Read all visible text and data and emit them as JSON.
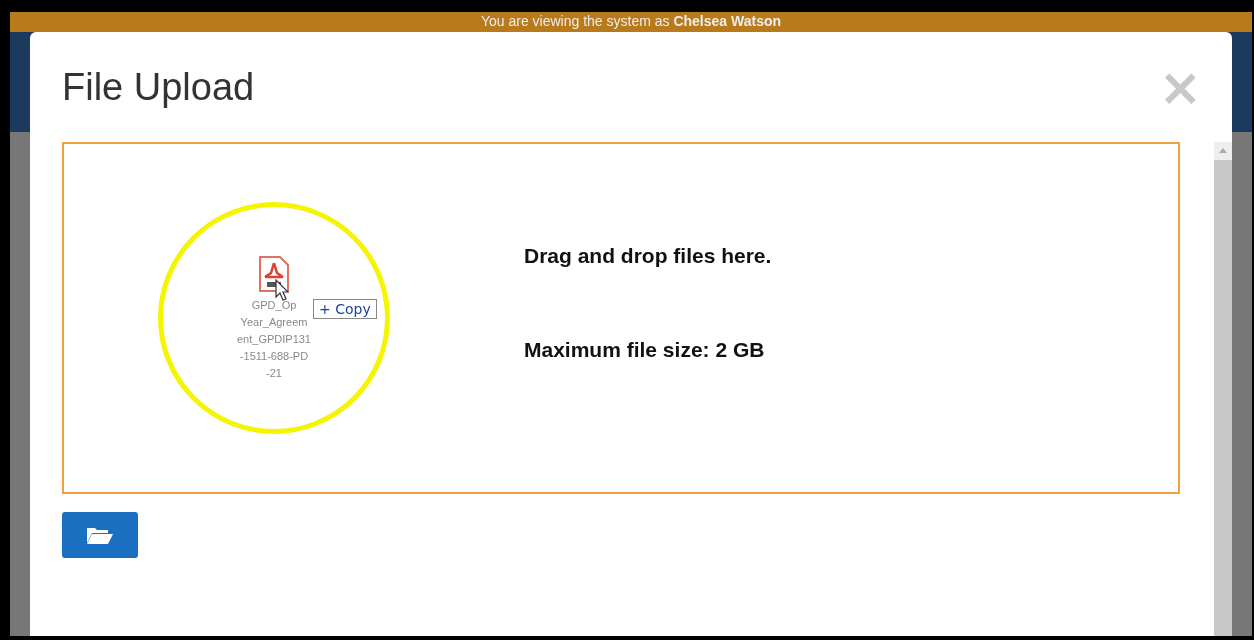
{
  "banner": {
    "text": "You are viewing the system as ",
    "user": "Chelsea Watson"
  },
  "dialog": {
    "title": "File Upload",
    "close": "×"
  },
  "drop_zone": {
    "instruction": "Drag and drop files here.",
    "limit": "Maximum file size: 2 GB",
    "dragged_file": {
      "name": "GPD_Op Year_Agreem ent_GPDIP131 -1511-688-PD -21",
      "action": "+ Copy"
    }
  }
}
